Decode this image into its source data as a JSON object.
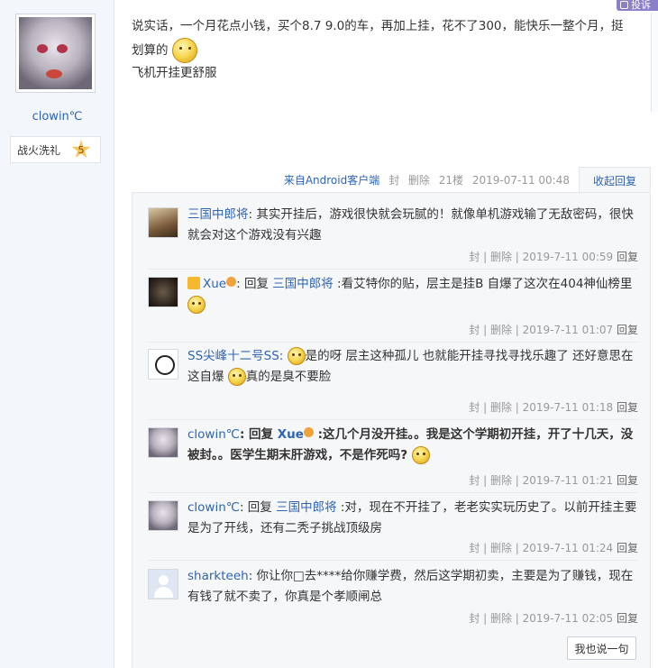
{
  "author": {
    "name": "clowin℃",
    "medal_label": "战火洗礼",
    "medal_level": "5"
  },
  "report_label": "投诉",
  "post": {
    "line1": "说实话，一个月花点小钱，买个8.7 9.0的车，再加上挂，花不了300，能快乐一整个月，挺",
    "line2": "划算的",
    "line3": "飞机开挂更舒服",
    "meta": {
      "source": "来自Android客户端",
      "seal": "封",
      "delete": "删除",
      "floor": "21楼",
      "time": "2019-07-11 00:48"
    },
    "collapse_label": "收起回复"
  },
  "replies": [
    {
      "user": "三国中郎将",
      "text": ": 其实开挂后，游戏很快就会玩腻的！就像单机游戏输了无敌密码，很快就会对这个游戏没有兴趣",
      "time": "2019-7-11 00:59"
    },
    {
      "user": "Xue",
      "prefix": ": 回复 ",
      "target": "三国中郎将",
      "text": " :看艾特你的贴，层主是挂B 自爆了这次在404神仙榜里",
      "time": "2019-7-11 01:07"
    },
    {
      "user": "SS尖峰十二号SS:",
      "text1": "是的呀 层主这种孤儿 也就能开挂寻找寻找乐趣了 还好意思在这自爆",
      "text2": "真的是臭不要脸",
      "time": "2019-7-11 01:18"
    },
    {
      "user": "clowin℃",
      "prefix": ": 回复 ",
      "target": "Xue",
      "text": " :这几个月没开挂。。我是这个学期初开挂，开了十几天，没被封。。医学生期末肝游戏，不是作死吗?",
      "time": "2019-7-11 01:21"
    },
    {
      "user": "clowin℃",
      "prefix": ": 回复 ",
      "target": "三国中郎将",
      "text": " :对，现在不开挂了，老老实实玩历史了。以前开挂主要是为了开线，还有二秃子挑战顶级房",
      "time": "2019-7-11 01:24"
    },
    {
      "user": "sharkteeh",
      "text": ": 你让你□去****给你赚学费，然后这学期初卖，主要是为了赚钱，现在有钱了就不卖了，你真是个孝顺闸总",
      "time": "2019-7-11 02:05"
    }
  ],
  "reply_actions": {
    "seal": "封",
    "delete": "删除",
    "reply": "回复"
  },
  "say_button": "我也说一句"
}
